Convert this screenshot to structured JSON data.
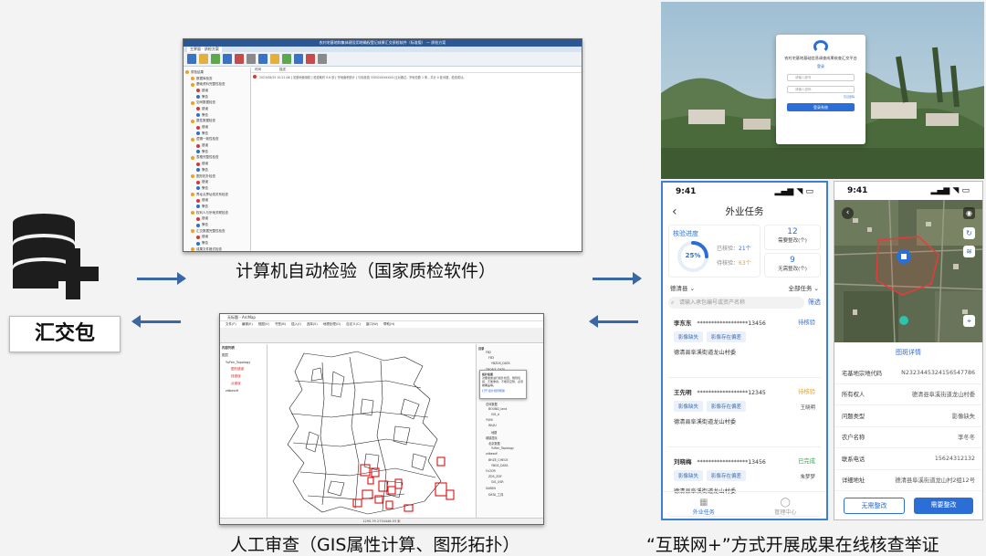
{
  "labels": {
    "auto_check": "计算机自动检验（国家质检软件）",
    "manual_review": "人工审查（GIS属性计算、图形拓扑）",
    "internet_plus": "“互联网+”方式开展成果在线核查举证",
    "package": "汇交包"
  },
  "window1": {
    "title": "农村宅基地和集体建设用地确权登记成果汇交质检软件（标准版） — 质检方案",
    "tab": "主界面 · 质检方案",
    "tree_items": [
      "质检结果",
      "数据库检查",
      "基础资料完整性检查",
      "错误",
      "警告",
      "空间数据检查",
      "错误",
      "警告",
      "属性数据检查",
      "错误",
      "警告",
      "逻辑一致性检查",
      "错误",
      "警告",
      "表格完整性检查",
      "错误",
      "警告",
      "图形拓扑检查",
      "错误",
      "警告",
      "界址点界址线关系检查",
      "错误",
      "警告",
      "权利人与宗地关联检查",
      "错误",
      "警告",
      "汇交数据完整性检查",
      "错误",
      "警告",
      "成果文件格式检查"
    ],
    "col_time": "时间",
    "col_desc": "描述",
    "row_text": "2023/08/25 10:21:08  [ 宅基地使用权 ] 检查耗时 0.6 秒 [ 宗地面积统计 ] 与标准值 33052XXXXXXX 比对通过，宗地总数 1 条，共计 0 处问题，检查成功。"
  },
  "window2": {
    "title": "无标题 - ArcMap",
    "menu": [
      "文件(F)",
      "编辑(E)",
      "视图(V)",
      "书签(B)",
      "插入(I)",
      "选择(S)",
      "地理处理(G)",
      "自定义(C)",
      "窗口(W)",
      "帮助(H)"
    ],
    "toc_title": "内容列表",
    "toc_items": [
      "图层",
      "YuFen_Topology",
      "图形错误",
      "线错误",
      "点错误",
      "zdbexdf"
    ],
    "catalog_title": "目录",
    "catalog_items": [
      "FB2",
      "FB3",
      "YBZDS_DATA",
      "TROFIT_DATA",
      "TB2",
      "已经收集",
      "ZD_ysdh",
      "GIS_人员",
      "BHZ",
      "总体数据",
      "BOUND_land",
      "GIS_A",
      "YUNI",
      "WUJU",
      "地籍",
      "城镇居民",
      "北京数据",
      "YuFen_Topology",
      "zdbexdf",
      "BHZE_CHECK",
      "YBGS_DATA",
      "FLOOR",
      "ZDS_ZDY",
      "GIS_USR",
      "SUBEN",
      "DATA_工具"
    ],
    "popup_title": "拓扑检查",
    "popup_text": "对要素类进行拓扑检查，规则包括：不能重叠、不能有空隙、必须被覆盖等。",
    "popup_item": "打开 拓扑规则帮助",
    "status": "1295.79  2734446.53 米"
  },
  "login": {
    "title": "农村宅基地基础信息调查成果核查汇交平台",
    "subtitle": "登录",
    "user_placeholder": "请输入账号",
    "pass_placeholder": "请输入密码",
    "forgot": "忘记密码",
    "button": "登录系统"
  },
  "phone1": {
    "time": "9:41",
    "title": "外业任务",
    "progress_title": "核验进度",
    "progress_pct": "25%",
    "progress": 0.25,
    "verified_label": "已核验：",
    "verified_count": "21个",
    "pending_label": "待核验：",
    "pending_count": "63个",
    "need_fix_num": "12",
    "need_fix_label": "需要整改(个)",
    "no_fix_num": "9",
    "no_fix_label": "无需整改(个)",
    "county": "德清县",
    "task_filter": "全部任务",
    "search_placeholder": "请输入承包编号或资产名称",
    "search_btn": "筛选",
    "cards": [
      {
        "name": "李东东",
        "id": "******************13456",
        "status": "待核验",
        "status_color": "#2b6fd6",
        "tag1": "影像缺失",
        "tag2": "影像存在偏差",
        "person": "",
        "addr": "德清县阜溪街道龙山村委"
      },
      {
        "name": "王先明",
        "id": "******************12345",
        "status": "待核验",
        "status_color": "#e8a317",
        "tag1": "影像缺失",
        "tag2": "影像存在偏差",
        "person": "王晓明",
        "addr": "德清县阜溪街道龙山村委"
      },
      {
        "name": "刘晓梅",
        "id": "******************13456",
        "status": "已完成",
        "status_color": "#3aa64b",
        "tag1": "影像缺失",
        "tag2": "影像存在偏差",
        "person": "朱梦梦",
        "addr": "德清县阜溪街道龙山村委"
      }
    ],
    "nav_task": "外业任务",
    "nav_me": "管理中心"
  },
  "phone2": {
    "time": "9:41",
    "detail_title": "图斑详情",
    "rows": [
      {
        "k": "宅基地宗地代码",
        "v": "N2323445324156547786"
      },
      {
        "k": "所有权人",
        "v": "德清县阜溪街道龙山村委"
      },
      {
        "k": "问题类型",
        "v": "影像缺失"
      },
      {
        "k": "农户名称",
        "v": "李冬冬"
      },
      {
        "k": "联系电话",
        "v": "15624312132"
      },
      {
        "k": "详细地址",
        "v": "德清县阜溪街道龙山村2组12号"
      }
    ],
    "btn_no": "无需整改",
    "btn_yes": "需要整改"
  }
}
